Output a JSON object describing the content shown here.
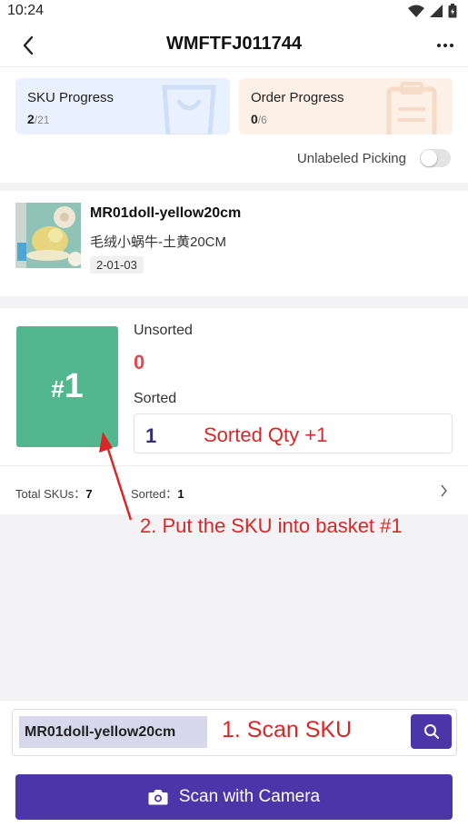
{
  "status_bar": {
    "time": "10:24"
  },
  "header": {
    "title": "WMFTFJ011744",
    "back_icon": "chevron-left-icon",
    "more_icon": "more-horizontal-icon"
  },
  "progress": {
    "sku": {
      "label": "SKU Progress",
      "current": "2",
      "total": "/21",
      "icon": "bag-icon",
      "color": "#e9f1fe"
    },
    "order": {
      "label": "Order Progress",
      "current": "0",
      "total": "/6",
      "icon": "clipboard-icon",
      "color": "#fdf0e6"
    }
  },
  "unlabeled": {
    "label": "Unlabeled Picking",
    "enabled": false
  },
  "item": {
    "sku": "MR01doll-yellow20cm",
    "name_cn": "毛绒小蜗牛-土黄20CM",
    "location": "2-01-03"
  },
  "basket": {
    "hash": "#",
    "number": "1",
    "color": "#52b68e"
  },
  "sorting": {
    "unsorted_label": "Unsorted",
    "unsorted_value": "0",
    "sorted_label": "Sorted",
    "sorted_value": "1"
  },
  "totals": {
    "total_label": "Total SKUs：",
    "total_value": "7",
    "sorted_label": "Sorted：",
    "sorted_value": "1"
  },
  "annotations": {
    "sorted_qty": "Sorted Qty +1",
    "put_basket": "2. Put the SKU into basket #1",
    "scan_sku": "1. Scan SKU"
  },
  "scan": {
    "input_value": "MR01doll-yellow20cm",
    "search_icon": "search-icon"
  },
  "camera_button": {
    "label": "Scan with Camera",
    "icon": "camera-icon"
  },
  "colors": {
    "accent": "#4a36a8",
    "unsorted": "#e04b4b",
    "annotation": "#d62828"
  }
}
